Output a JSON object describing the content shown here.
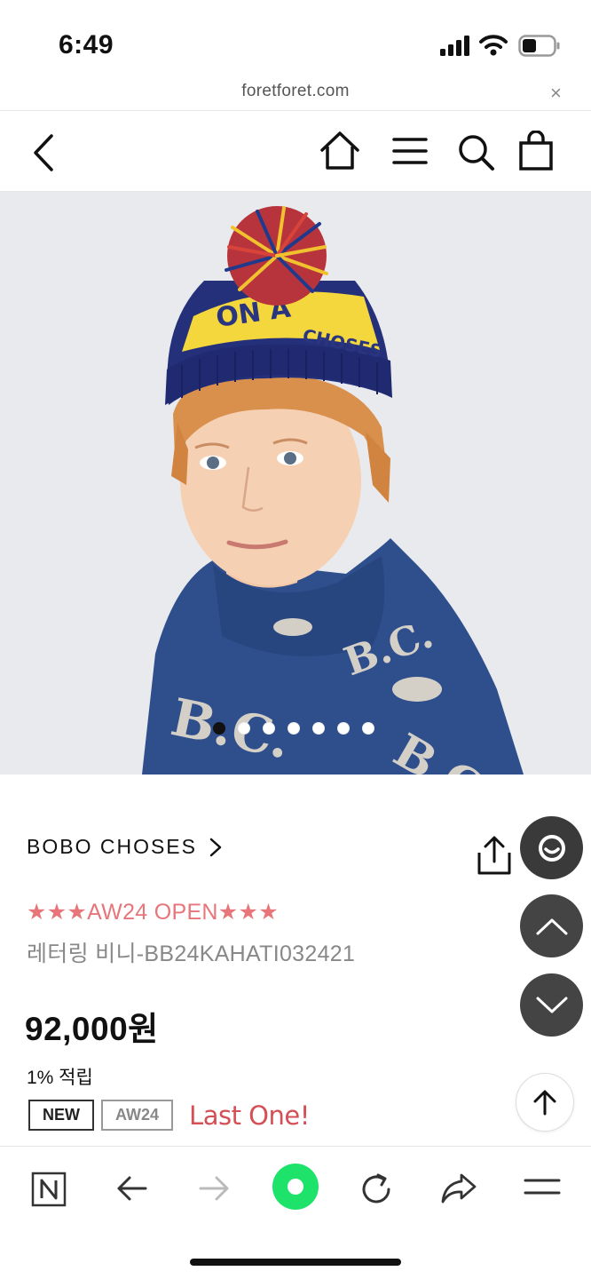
{
  "status_bar": {
    "time": "6:49"
  },
  "browser": {
    "url": "foretforet.com",
    "close_symbol": "×"
  },
  "site_header": {
    "icons": [
      "back-icon",
      "home-icon",
      "menu-icon",
      "search-icon",
      "cart-icon"
    ]
  },
  "hero": {
    "slide_count": 7,
    "active_slide": 1
  },
  "product": {
    "brand": "BOBO CHOSES",
    "promo": "★★★AW24 OPEN★★★",
    "name": "레터링 비니-BB24KAHATI032421",
    "price": "92,000원",
    "points": "1% 적립",
    "badges": [
      "NEW",
      "AW24"
    ],
    "tag": "Last One!"
  },
  "floating_buttons": [
    "chat-icon",
    "scroll-up-icon",
    "scroll-down-icon",
    "to-top-icon"
  ],
  "browser_toolbar": {
    "icons": [
      "naver-icon",
      "back-arrow-icon",
      "forward-arrow-icon",
      "green-dot-icon",
      "reload-icon",
      "share-arrow-icon",
      "menu-icon"
    ]
  },
  "colors": {
    "promo": "#e7757a",
    "tag": "#d54f56",
    "fab": "#444444",
    "green": "#1ee36a"
  }
}
